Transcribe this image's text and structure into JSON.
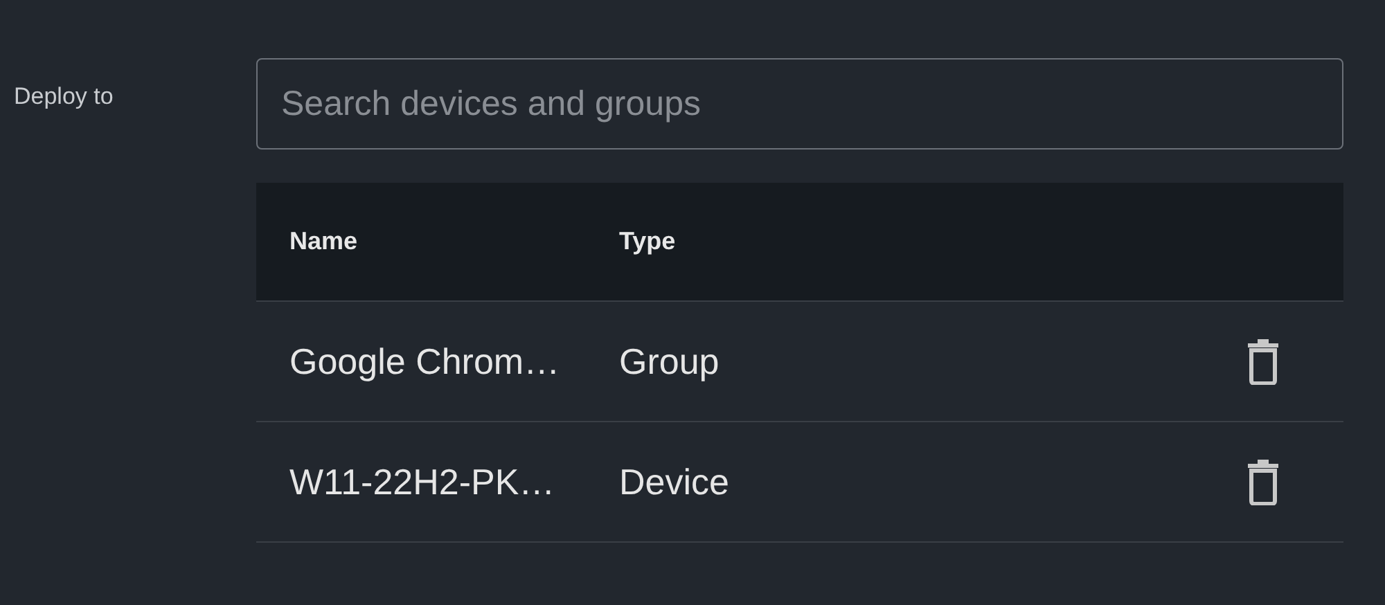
{
  "label": "Deploy to",
  "search": {
    "placeholder": "Search devices and groups"
  },
  "table": {
    "columns": [
      "Name",
      "Type"
    ],
    "rows": [
      {
        "name": "Google Chrom…",
        "type": "Group"
      },
      {
        "name": "W11-22H2-PK…",
        "type": "Device"
      }
    ]
  }
}
